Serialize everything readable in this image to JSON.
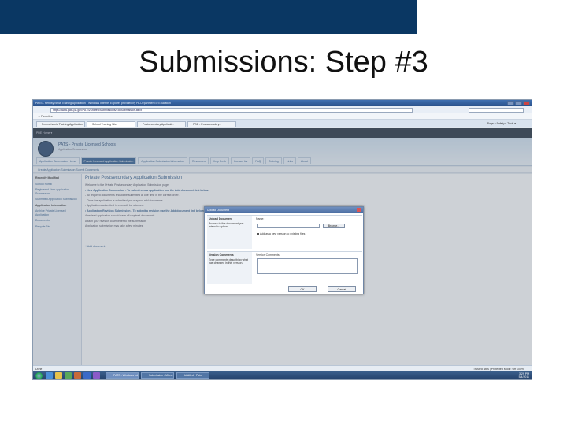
{
  "slide": {
    "title": "Submissions: Step #3",
    "bar_color": "#0a3763"
  },
  "browser": {
    "window_title": "PATS - Pennsylvania Training Application - Windows Internet Explorer provided by PA Department of Education",
    "address": "https://www.pats.pa.gov/PATS/Shared/Submissions/EditSubmission.aspx",
    "favorites_label": "Favorites",
    "tabs": [
      {
        "label": "Pennsylvania Training Application"
      },
      {
        "label": "School Training Site"
      },
      {
        "label": "Postsecondary Applicati..."
      },
      {
        "label": "PDE - Postsecondary..."
      }
    ],
    "toolbar_text": "Page ▾  Safety ▾  Tools ▾",
    "status_left": "Done",
    "status_right": "Trusted sites | Protected Mode: Off",
    "zoom": "100%"
  },
  "sharepoint": {
    "topbar_text": "PDE Home   ▾",
    "site_title": "PATS - Private Licensed Schools",
    "site_subtitle": "Application Submission",
    "nav_tabs": [
      {
        "label": "Application Submission Home",
        "active": false
      },
      {
        "label": "Private Licensed Application Submission",
        "active": true
      },
      {
        "label": "Application Submission Information",
        "active": false
      },
      {
        "label": "Resources",
        "active": false
      },
      {
        "label": "Help Desk",
        "active": false
      },
      {
        "label": "Contact Us",
        "active": false
      },
      {
        "label": "FAQ",
        "active": false
      },
      {
        "label": "Training",
        "active": false
      },
      {
        "label": "Links",
        "active": false
      },
      {
        "label": "About",
        "active": false
      }
    ],
    "subnav": "Create Application Submission    Submit Documents",
    "left_nav": [
      {
        "text": "Recently Modified",
        "header": true
      },
      {
        "text": "School Portal",
        "header": false
      },
      {
        "text": "Registered User Application Submission",
        "header": false
      },
      {
        "text": "Submitted Application Submission",
        "header": false
      },
      {
        "text": "Application Information",
        "header": true
      },
      {
        "text": "Archive Private Licensed Application",
        "header": false
      },
      {
        "text": "Documents",
        "header": false
      },
      {
        "text": "Recycle Bin",
        "header": false
      }
    ],
    "page_title": "Private Postsecondary Application Submission",
    "body_lines": [
      {
        "text": "Welcome to the Private Postsecondary Application Submission page.",
        "bold": false
      },
      {
        "text": "• New Application Submission - To submit a new application use the Add document link below.",
        "bold": true
      },
      {
        "text": "  - All required documents should be submitted at one time in the correct order.",
        "bold": false
      },
      {
        "text": "  - Once the application is submitted you may not add documents.",
        "bold": false
      },
      {
        "text": "  - Applications submitted in error will be returned.",
        "bold": false
      },
      {
        "text": "• Application Revision Submission - To submit a revision use the Add document link below.",
        "bold": true
      },
      {
        "text": "  A revised application should have all required documents.",
        "bold": false
      },
      {
        "text": "  Attach your revision cover letter to the submission.",
        "bold": false
      },
      {
        "text": "  Application submission may take a few minutes.",
        "bold": false
      }
    ],
    "add_document": "+ Add document"
  },
  "dialog": {
    "title": "Upload Document",
    "section1_heading": "Upload Document",
    "section1_desc": "Browse to the document you intend to upload.",
    "name_label": "Name:",
    "browse_label": "Browse...",
    "overwrite_label": "Add as a new version to existing files",
    "section2_heading": "Version Comments",
    "section2_desc": "Type comments describing what has changed in this version.",
    "comments_label": "Version Comments:",
    "ok_label": "OK",
    "cancel_label": "Cancel"
  },
  "taskbar": {
    "items": [
      {
        "label": "PATS - Windows Inte..."
      },
      {
        "label": "Submission - Micro..."
      },
      {
        "label": "Untitled - Paint"
      }
    ],
    "clock_time": "3:29 PM",
    "clock_date": "5/4/2011"
  }
}
